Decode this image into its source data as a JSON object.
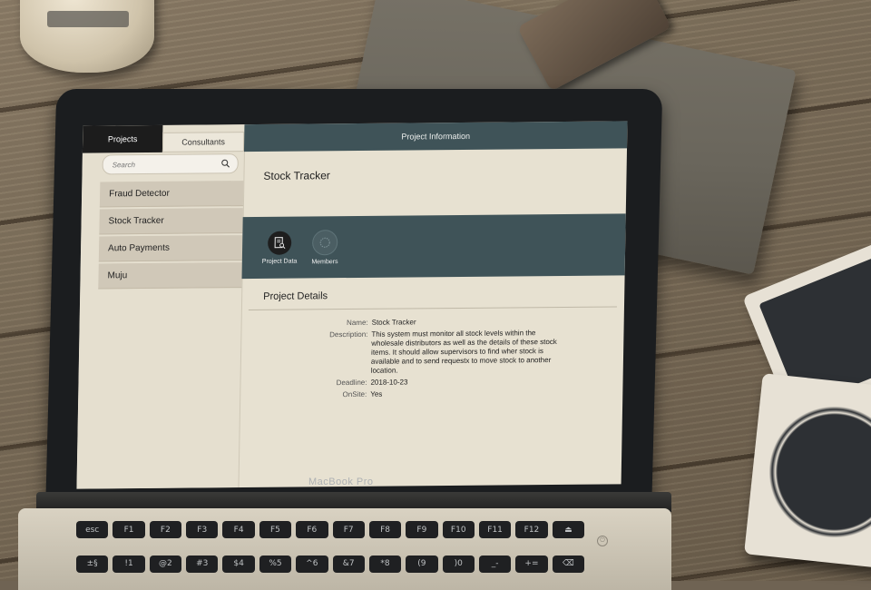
{
  "sidebar": {
    "tabs": [
      {
        "label": "Projects",
        "active": true
      },
      {
        "label": "Consultants",
        "active": false
      }
    ],
    "search_placeholder": "Search",
    "projects": [
      "Fraud Detector",
      "Stock Tracker",
      "Auto Payments",
      "Muju"
    ]
  },
  "main": {
    "header": "Project Information",
    "project_title": "Stock Tracker",
    "actions": [
      {
        "label": "Project Data",
        "icon": "document-search-icon"
      },
      {
        "label": "Members",
        "icon": "members-icon"
      }
    ],
    "section_title": "Project Details",
    "details": [
      {
        "label": "Name:",
        "value": "Stock Tracker"
      },
      {
        "label": "Description:",
        "value": "This system must monitor all stock levels within the wholesale distributors as well as the details of these stock items. It should allow supervisors to find wher stock is available and to send requestx to move stock to another location."
      },
      {
        "label": "Deadline:",
        "value": "2018-10-23"
      },
      {
        "label": "OnSite:",
        "value": "Yes"
      }
    ]
  },
  "laptop": {
    "brand": "MacBook Pro",
    "keys": [
      "esc",
      "F1",
      "F2",
      "F3",
      "F4",
      "F5",
      "F6",
      "F7",
      "F8",
      "F9",
      "F10",
      "F11",
      "F12",
      "⏏",
      "±§",
      "!1",
      "@2",
      "#3",
      "$4",
      "%5",
      "^6",
      "&7",
      "*8",
      "(9",
      ")0",
      "_-",
      "+=",
      "⌫"
    ]
  },
  "colors": {
    "header_bg": "#3f5358",
    "screen_bg": "#e7e1d1",
    "list_item_bg": "#d0c8b8",
    "active_tab_bg": "#1c1c1c"
  }
}
